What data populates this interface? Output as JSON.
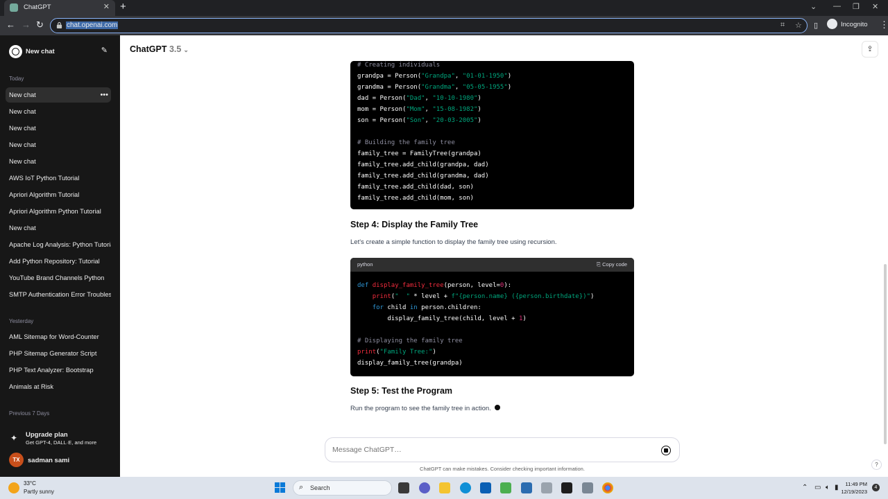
{
  "browser": {
    "tab_title": "ChatGPT",
    "url": "chat.openai.com",
    "profile_label": "Incognito"
  },
  "sidebar": {
    "new_chat_label": "New chat",
    "sections": [
      {
        "title": "Today",
        "items": [
          "New chat",
          "New chat",
          "New chat",
          "New chat",
          "New chat",
          "AWS IoT Python Tutorial",
          "Apriori Algorithm Tutorial",
          "Apriori Algorithm Python Tutorial",
          "New chat",
          "Apache Log Analysis: Python Tutorial",
          "Add Python Repository: Tutorial",
          "YouTube Brand Channels Python",
          "SMTP Authentication Error Troubleshooting"
        ]
      },
      {
        "title": "Yesterday",
        "items": [
          "AML Sitemap for Word-Counter",
          "PHP Sitemap Generator Script",
          "PHP Text Analyzer: Bootstrap",
          "Animals at Risk"
        ]
      },
      {
        "title": "Previous 7 Days",
        "items": []
      }
    ],
    "upgrade": {
      "title": "Upgrade plan",
      "subtitle": "Get GPT-4, DALL·E, and more"
    },
    "user": {
      "initials": "TX",
      "name": "sadman sami"
    }
  },
  "header": {
    "model_name": "ChatGPT",
    "model_version": "3.5"
  },
  "content": {
    "code_block_1": [
      [
        [
          "c",
          "# Creating individuals"
        ]
      ],
      [
        [
          "t",
          "grandpa = Person("
        ],
        [
          "s",
          "\"Grandpa\""
        ],
        [
          "t",
          ", "
        ],
        [
          "s",
          "\"01-01-1950\""
        ],
        [
          "t",
          ")"
        ]
      ],
      [
        [
          "t",
          "grandma = Person("
        ],
        [
          "s",
          "\"Grandma\""
        ],
        [
          "t",
          ", "
        ],
        [
          "s",
          "\"05-05-1955\""
        ],
        [
          "t",
          ")"
        ]
      ],
      [
        [
          "t",
          "dad = Person("
        ],
        [
          "s",
          "\"Dad\""
        ],
        [
          "t",
          ", "
        ],
        [
          "s",
          "\"10-10-1980\""
        ],
        [
          "t",
          ")"
        ]
      ],
      [
        [
          "t",
          "mom = Person("
        ],
        [
          "s",
          "\"Mom\""
        ],
        [
          "t",
          ", "
        ],
        [
          "s",
          "\"15-08-1982\""
        ],
        [
          "t",
          ")"
        ]
      ],
      [
        [
          "t",
          "son = Person("
        ],
        [
          "s",
          "\"Son\""
        ],
        [
          "t",
          ", "
        ],
        [
          "s",
          "\"20-03-2005\""
        ],
        [
          "t",
          ")"
        ]
      ],
      [],
      [
        [
          "c",
          "# Building the family tree"
        ]
      ],
      [
        [
          "t",
          "family_tree = FamilyTree(grandpa)"
        ]
      ],
      [
        [
          "t",
          "family_tree.add_child(grandpa, dad)"
        ]
      ],
      [
        [
          "t",
          "family_tree.add_child(grandma, dad)"
        ]
      ],
      [
        [
          "t",
          "family_tree.add_child(dad, son)"
        ]
      ],
      [
        [
          "t",
          "family_tree.add_child(mom, son)"
        ]
      ]
    ],
    "step4_heading": "Step 4: Display the Family Tree",
    "step4_text": "Let's create a simple function to display the family tree using recursion.",
    "code_block_2": {
      "language": "python",
      "copy_label": "Copy code",
      "lines": [
        [
          [
            "k",
            "def "
          ],
          [
            "f",
            "display_family_tree"
          ],
          [
            "t",
            "(person, level="
          ],
          [
            "n",
            "0"
          ],
          [
            "t",
            "):"
          ]
        ],
        [
          [
            "t",
            "    "
          ],
          [
            "f",
            "print"
          ],
          [
            "t",
            "("
          ],
          [
            "s",
            "\"  \""
          ],
          [
            "t",
            " * level + "
          ],
          [
            "s",
            "f\"{person.name} ({person.birthdate})\""
          ],
          [
            "t",
            ")"
          ]
        ],
        [
          [
            "t",
            "    "
          ],
          [
            "k",
            "for"
          ],
          [
            "t",
            " child "
          ],
          [
            "k",
            "in"
          ],
          [
            "t",
            " person.children:"
          ]
        ],
        [
          [
            "t",
            "        display_family_tree(child, level + "
          ],
          [
            "n",
            "1"
          ],
          [
            "t",
            ")"
          ]
        ],
        [],
        [
          [
            "c",
            "# Displaying the family tree"
          ]
        ],
        [
          [
            "f",
            "print"
          ],
          [
            "t",
            "("
          ],
          [
            "s",
            "\"Family Tree:\""
          ],
          [
            "t",
            ")"
          ]
        ],
        [
          [
            "t",
            "display_family_tree(grandpa)"
          ]
        ]
      ]
    },
    "step5_heading": "Step 5: Test the Program",
    "step5_text": "Run the program to see the family tree in action."
  },
  "composer": {
    "placeholder": "Message ChatGPT…"
  },
  "disclaimer": "ChatGPT can make mistakes. Consider checking important information.",
  "help_label": "?",
  "taskbar": {
    "weather_temp": "33°C",
    "weather_desc": "Partly sunny",
    "search_label": "Search",
    "time": "11:49 PM",
    "date": "12/19/2023",
    "notification_count": "4"
  },
  "colors": {
    "sidebar_bg": "#171717",
    "code_bg": "#000000",
    "accent_blue": "#8ab4f8"
  }
}
